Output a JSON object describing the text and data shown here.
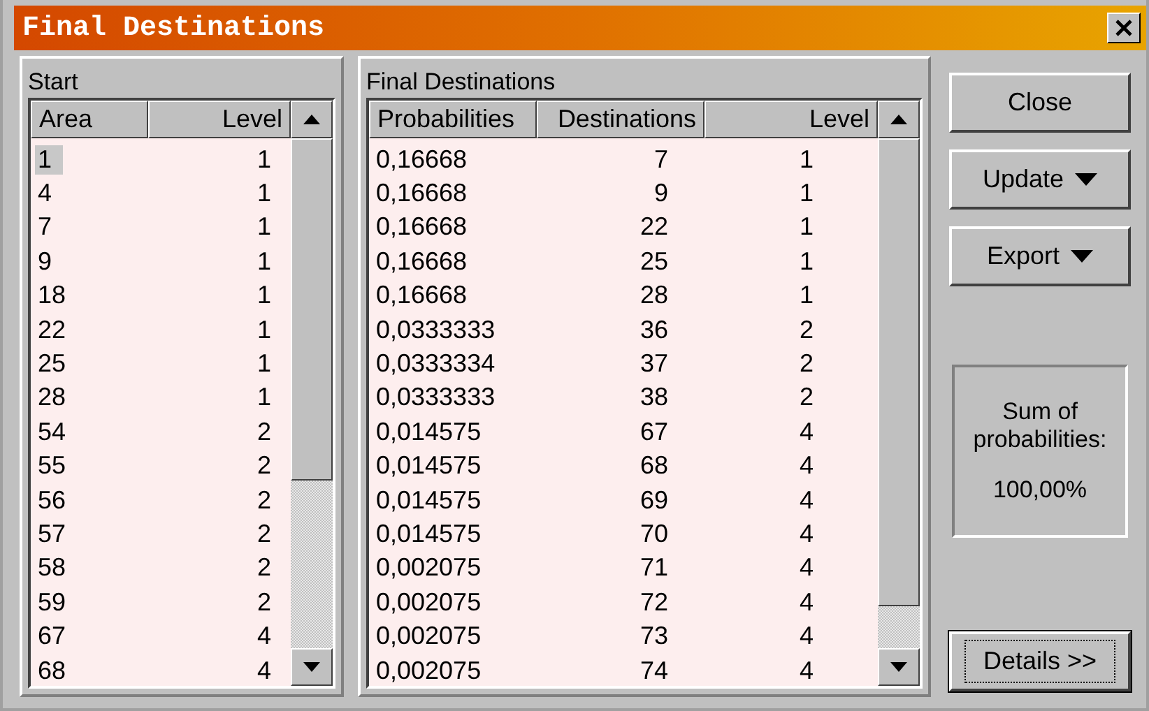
{
  "window": {
    "title": "Final Destinations"
  },
  "start": {
    "label": "Start",
    "columns": [
      "Area",
      "Level"
    ],
    "rows": [
      {
        "cells": [
          "1",
          "1"
        ],
        "selected": true
      },
      {
        "cells": [
          "4",
          "1"
        ],
        "selected": false
      },
      {
        "cells": [
          "7",
          "1"
        ],
        "selected": false
      },
      {
        "cells": [
          "9",
          "1"
        ],
        "selected": false
      },
      {
        "cells": [
          "18",
          "1"
        ],
        "selected": false
      },
      {
        "cells": [
          "22",
          "1"
        ],
        "selected": false
      },
      {
        "cells": [
          "25",
          "1"
        ],
        "selected": false
      },
      {
        "cells": [
          "28",
          "1"
        ],
        "selected": false
      },
      {
        "cells": [
          "54",
          "2"
        ],
        "selected": false
      },
      {
        "cells": [
          "55",
          "2"
        ],
        "selected": false
      },
      {
        "cells": [
          "56",
          "2"
        ],
        "selected": false
      },
      {
        "cells": [
          "57",
          "2"
        ],
        "selected": false
      },
      {
        "cells": [
          "58",
          "2"
        ],
        "selected": false
      },
      {
        "cells": [
          "59",
          "2"
        ],
        "selected": false
      },
      {
        "cells": [
          "67",
          "4"
        ],
        "selected": false
      },
      {
        "cells": [
          "68",
          "4"
        ],
        "selected": false
      }
    ]
  },
  "destinations": {
    "label": "Final Destinations",
    "columns": [
      "Probabilities",
      "Destinations",
      "Level"
    ],
    "rows": [
      [
        "0,16668",
        "7",
        "1"
      ],
      [
        "0,16668",
        "9",
        "1"
      ],
      [
        "0,16668",
        "22",
        "1"
      ],
      [
        "0,16668",
        "25",
        "1"
      ],
      [
        "0,16668",
        "28",
        "1"
      ],
      [
        "0,0333333",
        "36",
        "2"
      ],
      [
        "0,0333334",
        "37",
        "2"
      ],
      [
        "0,0333333",
        "38",
        "2"
      ],
      [
        "0,014575",
        "67",
        "4"
      ],
      [
        "0,014575",
        "68",
        "4"
      ],
      [
        "0,014575",
        "69",
        "4"
      ],
      [
        "0,014575",
        "70",
        "4"
      ],
      [
        "0,002075",
        "71",
        "4"
      ],
      [
        "0,002075",
        "72",
        "4"
      ],
      [
        "0,002075",
        "73",
        "4"
      ],
      [
        "0,002075",
        "74",
        "4"
      ]
    ]
  },
  "buttons": [
    {
      "label": "Close",
      "kind": "plain"
    },
    {
      "label": "Update",
      "kind": "menu"
    },
    {
      "label": "Export",
      "kind": "menu"
    }
  ],
  "summary": {
    "label": "Sum of probabilities:",
    "value": "100,00%"
  },
  "details_button": {
    "label": "Details >>",
    "focused": true
  }
}
